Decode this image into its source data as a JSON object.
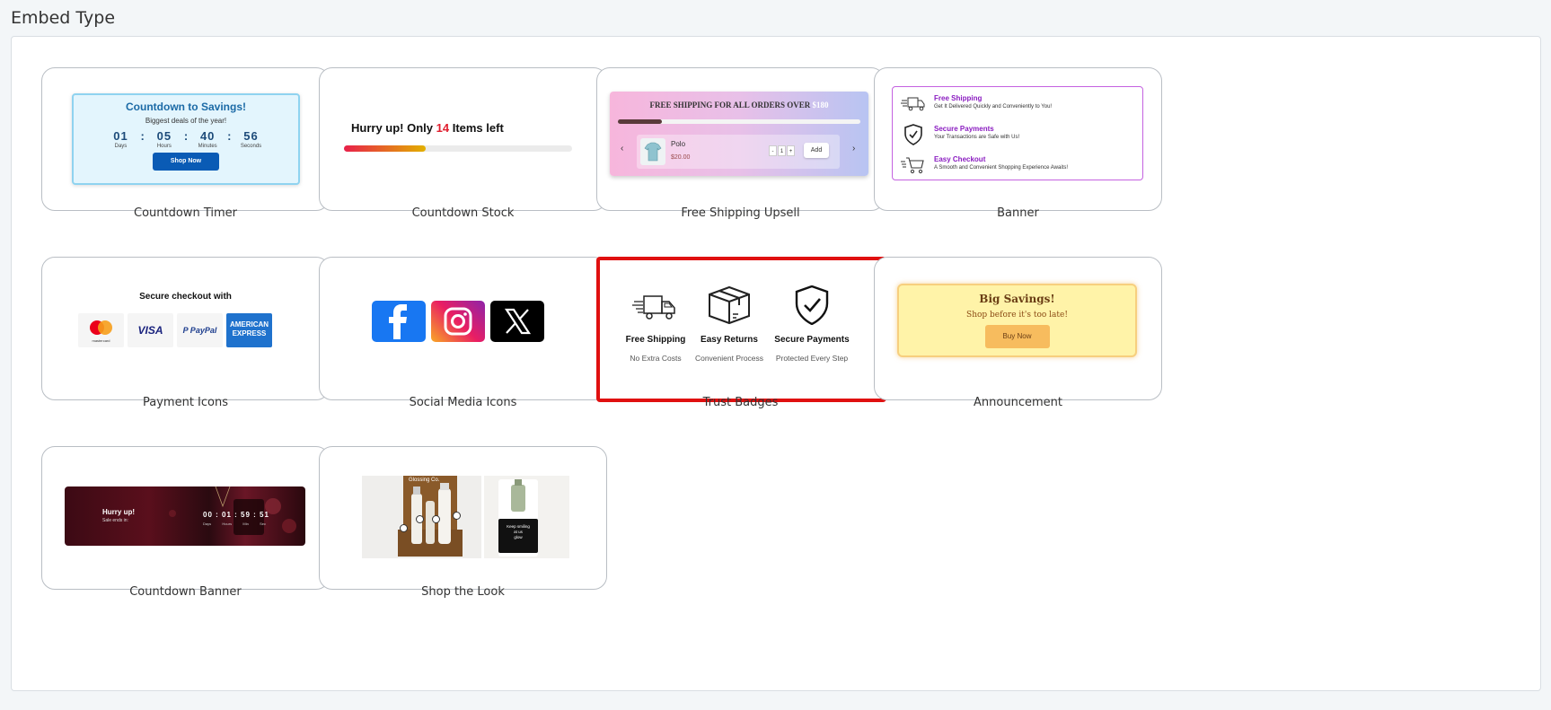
{
  "page": {
    "title": "Embed Type"
  },
  "cards": {
    "countdown_timer": {
      "label": "Countdown Timer",
      "heading": "Countdown to Savings!",
      "subheading": "Biggest deals of the year!",
      "units": [
        {
          "value": "01",
          "label": "Days"
        },
        {
          "value": "05",
          "label": "Hours"
        },
        {
          "value": "40",
          "label": "Minutes"
        },
        {
          "value": "56",
          "label": "Seconds"
        }
      ],
      "button": "Shop Now"
    },
    "countdown_stock": {
      "label": "Countdown Stock",
      "text_before": "Hurry up! Only ",
      "count": "14",
      "text_after": " Items left",
      "progress_fraction": 0.36
    },
    "free_shipping_upsell": {
      "label": "Free Shipping Upsell",
      "heading": "FREE SHIPPING FOR ALL ORDERS OVER ",
      "amount": "$180",
      "progress_fraction": 0.18,
      "product_name": "Polo",
      "product_price": "$20.00",
      "qty_minus": "-",
      "qty_value": "1",
      "qty_plus": "+",
      "add_button": "Add",
      "prev_arrow": "‹",
      "next_arrow": "›"
    },
    "banner": {
      "label": "Banner",
      "items": [
        {
          "icon": "truck-icon",
          "title": "Free Shipping",
          "subtitle": "Get It Delivered Quickly and Conveniently to You!"
        },
        {
          "icon": "shield-check-icon",
          "title": "Secure Payments",
          "subtitle": "Your Transactions are Safe with Us!"
        },
        {
          "icon": "cart-icon",
          "title": "Easy Checkout",
          "subtitle": "A Smooth and Convenient Shopping Experience Awaits!"
        }
      ]
    },
    "payment_icons": {
      "label": "Payment Icons",
      "heading": "Secure checkout with",
      "mastercard_label": "mastercard",
      "visa": "VISA",
      "paypal": "P PayPal",
      "amex_line1": "AMERICAN",
      "amex_line2": "EXPRESS"
    },
    "social_media_icons": {
      "label": "Social Media Icons",
      "icons": [
        "facebook-icon",
        "instagram-icon",
        "x-icon"
      ],
      "colors": {
        "facebook": "#1877f2",
        "x": "#000000"
      }
    },
    "trust_badges": {
      "label": "Trust Badges",
      "selected": true,
      "items": [
        {
          "icon": "truck-icon",
          "title": "Free Shipping",
          "subtitle": "No Extra Costs"
        },
        {
          "icon": "box-icon",
          "title": "Easy Returns",
          "subtitle": "Convenient Process"
        },
        {
          "icon": "shield-check-icon",
          "title": "Secure Payments",
          "subtitle": "Protected Every Step"
        }
      ]
    },
    "announcement": {
      "label": "Announcement",
      "heading": "Big Savings!",
      "subheading": "Shop before it's too late!",
      "button": "Buy Now"
    },
    "countdown_banner": {
      "label": "Countdown Banner",
      "heading": "Hurry up!",
      "subheading": "Sale ends in:",
      "time": "00 : 01 : 59 : 51",
      "unit_labels": [
        "Days",
        "Hours",
        "Min",
        "Sec"
      ]
    },
    "shop_the_look": {
      "label": "Shop the Look",
      "brand": "Glossing Co.",
      "caption": "Keep smiling\nat us\nglow"
    }
  },
  "colors": {
    "selected_border": "#e01010",
    "accent_blue": "#0a5bb5",
    "accent_purple": "#8a1cc0"
  }
}
